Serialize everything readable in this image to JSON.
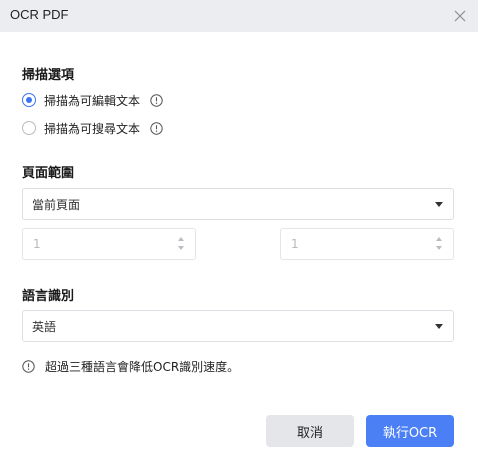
{
  "window": {
    "title": "OCR PDF"
  },
  "scan_options": {
    "heading": "掃描選項",
    "options": [
      {
        "label": "掃描為可編輯文本",
        "checked": true
      },
      {
        "label": "掃描為可搜尋文本",
        "checked": false
      }
    ]
  },
  "page_range": {
    "heading": "頁面範圍",
    "selected": "當前頁面",
    "from_value": "1",
    "to_value": "1"
  },
  "language": {
    "heading": "語言識別",
    "selected": "英語",
    "note": "超過三種語言會降低OCR識別速度。"
  },
  "buttons": {
    "cancel": "取消",
    "run": "執行OCR"
  },
  "colors": {
    "accent": "#4a7ff5",
    "titlebar_bg": "#ebedf0",
    "cancel_bg": "#e4e6ea"
  },
  "icons": {
    "close": "close-icon",
    "info": "info-icon",
    "caret": "caret-down-icon",
    "stepper": "stepper-icon"
  }
}
